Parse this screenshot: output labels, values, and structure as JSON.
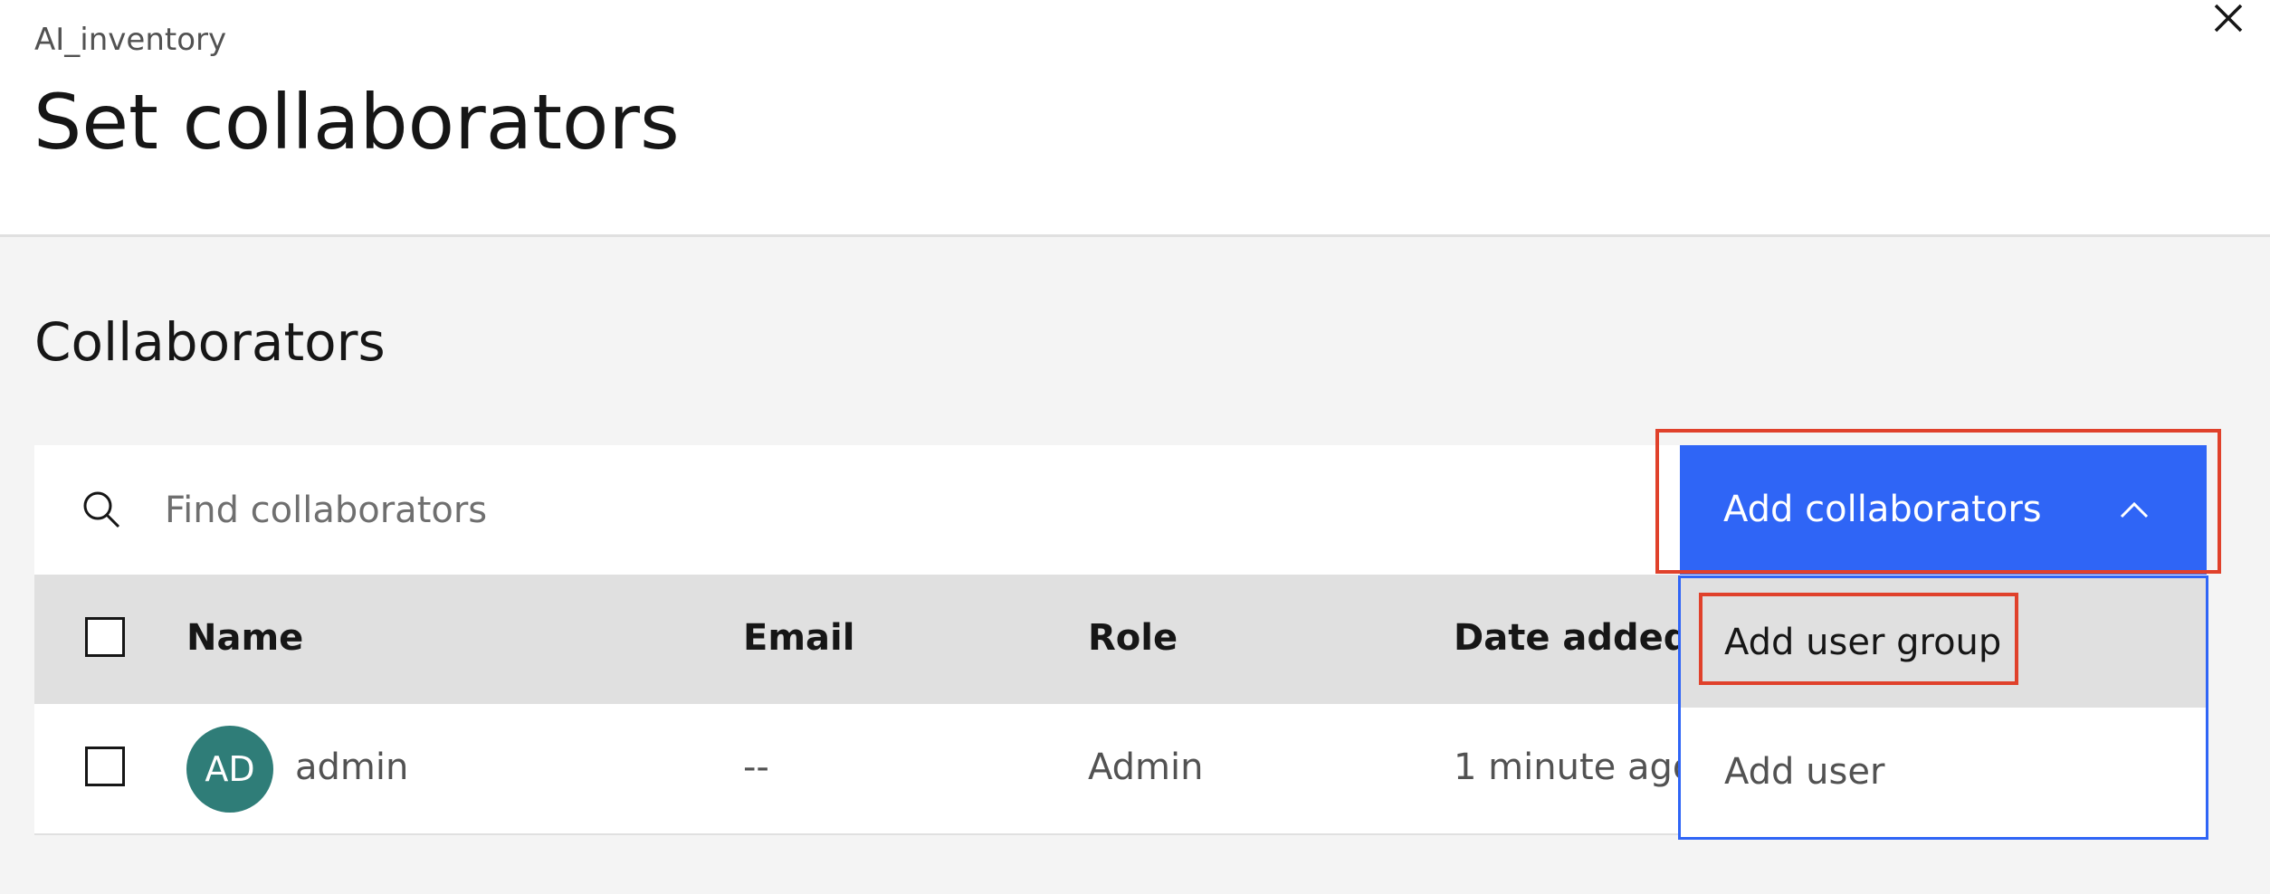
{
  "header": {
    "breadcrumb": "AI_inventory",
    "title": "Set collaborators",
    "close_icon": "close-icon"
  },
  "collaborators": {
    "section_title": "Collaborators",
    "search": {
      "placeholder": "Find collaborators",
      "value": "",
      "icon": "search-icon"
    },
    "add_button": {
      "label": "Add collaborators",
      "icon": "chevron-up-icon",
      "color": "#2f65f6"
    },
    "menu": {
      "items": [
        {
          "label": "Add user group",
          "highlighted": true
        },
        {
          "label": "Add user",
          "highlighted": false
        }
      ]
    },
    "table": {
      "columns": [
        "Name",
        "Email",
        "Role",
        "Date added"
      ],
      "rows": [
        {
          "avatar_initials": "AD",
          "avatar_color": "#2f7d78",
          "name": "admin",
          "email": "--",
          "role": "Admin",
          "date_added": "1 minute ago"
        }
      ]
    }
  },
  "annotation_color": "#e0412b"
}
